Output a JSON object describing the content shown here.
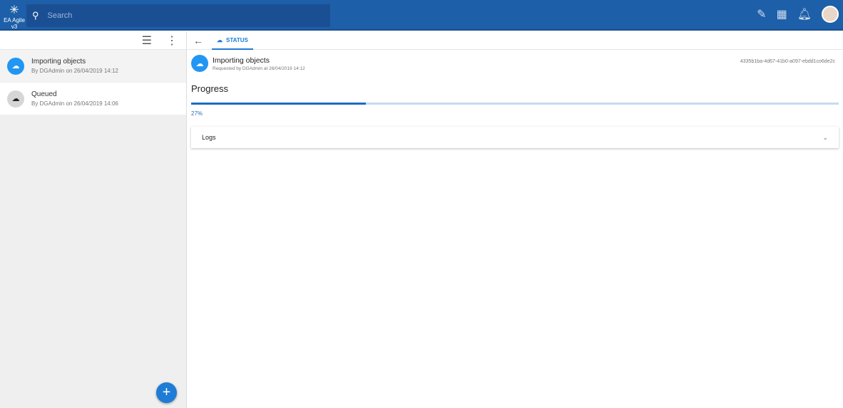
{
  "app": {
    "name": "EA Agile v3",
    "search_placeholder": "Search"
  },
  "list": [
    {
      "title": "Importing objects",
      "subtitle": "By DGAdmin on 26/04/2019 14:12",
      "color": "#2196f3"
    },
    {
      "title": "Queued",
      "subtitle": "By DGAdmin on 26/04/2019 14:06",
      "color": "#d6d6d6"
    }
  ],
  "tab": {
    "label": "STATUS"
  },
  "detail": {
    "title": "Importing objects",
    "subtitle": "Requested by DGAdmin at 26/04/2019 14:12",
    "id": "4335b1ba-4d67-41b0-a097-ebdd1co6de2c",
    "progress_label": "Progress",
    "progress": 27,
    "progress_text": "27%",
    "logs_label": "Logs"
  }
}
